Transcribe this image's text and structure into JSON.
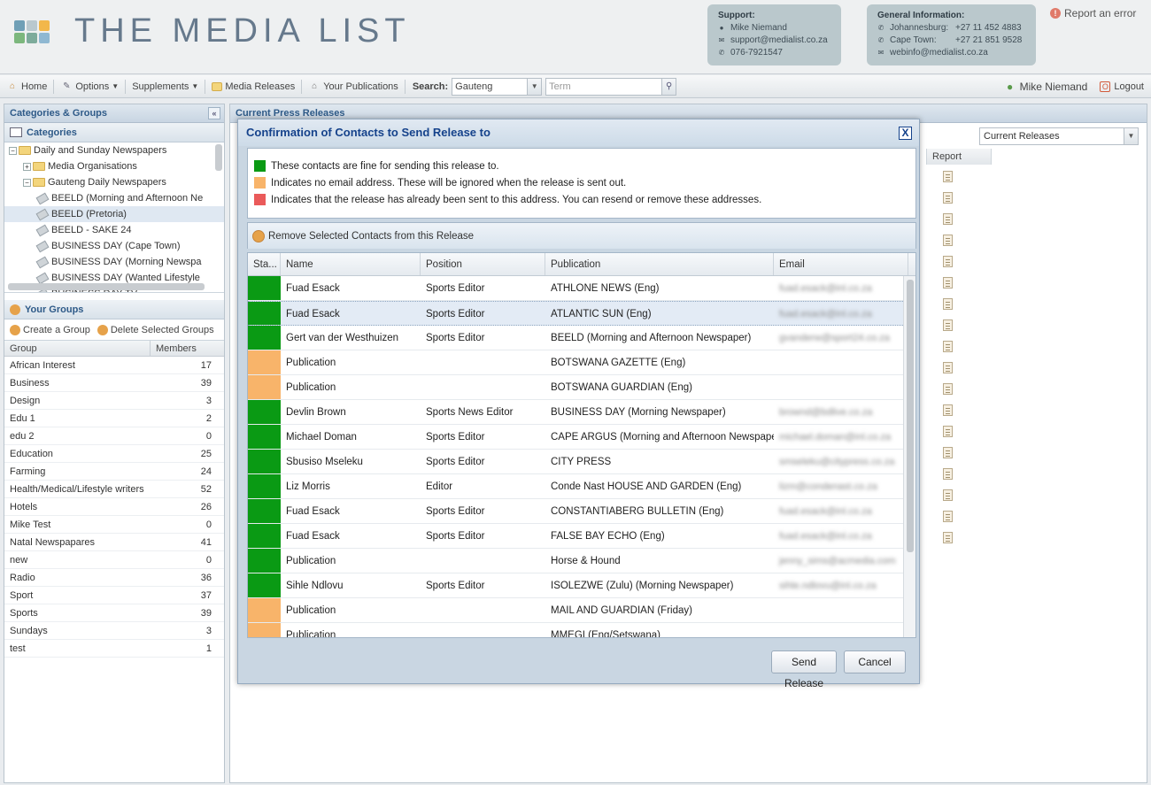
{
  "header": {
    "logo_text": "THE MEDIA LIST",
    "logo_colors": [
      "#6f9fb6",
      "#b9c8ce",
      "#f2b74a",
      "#7cb77d",
      "#7dab9b",
      "#8fb8d2"
    ],
    "support": {
      "title": "Support:",
      "name": "Mike Niemand",
      "email": "support@medialist.co.za",
      "phone": "076-7921547"
    },
    "general": {
      "title": "General Information:",
      "jhb_label": "Johannesburg:",
      "jhb_phone": "+27 11 452 4883",
      "cpt_label": "Cape Town:",
      "cpt_phone": "+27 21 851 9528",
      "email": "webinfo@medialist.co.za"
    },
    "report_error": "Report an error"
  },
  "toolbar": {
    "home": "Home",
    "options": "Options",
    "supplements": "Supplements",
    "media_releases": "Media Releases",
    "your_publications": "Your Publications",
    "search_label": "Search:",
    "search_select": "Gauteng",
    "search_placeholder": "Term",
    "user": "Mike Niemand",
    "logout": "Logout"
  },
  "left": {
    "panel_title": "Categories & Groups",
    "categories_title": "Categories",
    "tree": [
      {
        "label": "Daily and Sunday Newspapers",
        "indent": 0,
        "type": "folder-open"
      },
      {
        "label": "Media Organisations",
        "indent": 1,
        "type": "folder-closed"
      },
      {
        "label": "Gauteng Daily Newspapers",
        "indent": 1,
        "type": "folder-open"
      },
      {
        "label": "BEELD (Morning and Afternoon Ne",
        "indent": 2,
        "type": "tag"
      },
      {
        "label": "BEELD (Pretoria)",
        "indent": 2,
        "type": "tag",
        "selected": true
      },
      {
        "label": "BEELD - SAKE 24",
        "indent": 2,
        "type": "tag"
      },
      {
        "label": "BUSINESS DAY (Cape Town)",
        "indent": 2,
        "type": "tag"
      },
      {
        "label": "BUSINESS DAY (Morning Newspa",
        "indent": 2,
        "type": "tag"
      },
      {
        "label": "BUSINESS DAY (Wanted Lifestyle",
        "indent": 2,
        "type": "tag"
      },
      {
        "label": "BUSINESS DAY TV",
        "indent": 2,
        "type": "tag"
      }
    ],
    "groups_title": "Your Groups",
    "create_group": "Create a Group",
    "delete_groups": "Delete Selected Groups",
    "group_col": "Group",
    "members_col": "Members",
    "groups": [
      {
        "name": "African Interest",
        "members": "17"
      },
      {
        "name": "Business",
        "members": "39"
      },
      {
        "name": "Design",
        "members": "3"
      },
      {
        "name": "Edu 1",
        "members": "2"
      },
      {
        "name": "edu 2",
        "members": "0"
      },
      {
        "name": "Education",
        "members": "25"
      },
      {
        "name": "Farming",
        "members": "24"
      },
      {
        "name": "Health/Medical/Lifestyle writers",
        "members": "52"
      },
      {
        "name": "Hotels",
        "members": "26"
      },
      {
        "name": "Mike Test",
        "members": "0"
      },
      {
        "name": "Natal Newspapares",
        "members": "41"
      },
      {
        "name": "new",
        "members": "0"
      },
      {
        "name": "Radio",
        "members": "36"
      },
      {
        "name": "Sport",
        "members": "37"
      },
      {
        "name": "Sports",
        "members": "39"
      },
      {
        "name": "Sundays",
        "members": "3"
      },
      {
        "name": "test",
        "members": "1"
      }
    ]
  },
  "right": {
    "panel_title": "Current Press Releases",
    "filter_select": "Current Releases",
    "report_col": "Report"
  },
  "modal": {
    "title": "Confirmation of Contacts to Send Release to",
    "close": "X",
    "legend": [
      {
        "color": "#0a9a14",
        "text": "These contacts are fine for sending this release to."
      },
      {
        "color": "#f8b46a",
        "text": "Indicates no email address. These will be ignored when the release is sent out."
      },
      {
        "color": "#ea5a5a",
        "text": "Indicates that the release has already been sent to this address. You can resend or remove these addresses."
      }
    ],
    "remove_label": "Remove Selected Contacts from this Release",
    "columns": [
      "Sta...",
      "Name",
      "Position",
      "Publication",
      "Email"
    ],
    "rows": [
      {
        "status": "#0a9a14",
        "name": "Fuad Esack",
        "position": "Sports Editor",
        "publication": "ATHLONE NEWS (Eng)",
        "email": "fuad.esack@inl.co.za"
      },
      {
        "status": "#0a9a14",
        "name": "Fuad Esack",
        "position": "Sports Editor",
        "publication": "ATLANTIC SUN (Eng)",
        "email": "fuad.esack@inl.co.za",
        "highlight": true
      },
      {
        "status": "#0a9a14",
        "name": "Gert van der Westhuizen",
        "position": "Sports Editor",
        "publication": "BEELD (Morning and Afternoon Newspaper)",
        "email": "gvanderw@sport24.co.za"
      },
      {
        "status": "#f8b46a",
        "name": "Publication",
        "position": "",
        "publication": "BOTSWANA GAZETTE (Eng)",
        "email": ""
      },
      {
        "status": "#f8b46a",
        "name": "Publication",
        "position": "",
        "publication": "BOTSWANA GUARDIAN (Eng)",
        "email": ""
      },
      {
        "status": "#0a9a14",
        "name": "Devlin Brown",
        "position": "Sports News Editor",
        "publication": "BUSINESS DAY (Morning Newspaper)",
        "email": "brownd@bdlive.co.za"
      },
      {
        "status": "#0a9a14",
        "name": "Michael Doman",
        "position": "Sports Editor",
        "publication": "CAPE ARGUS (Morning and Afternoon Newspaper)",
        "email": "michael.doman@inl.co.za"
      },
      {
        "status": "#0a9a14",
        "name": "Sbusiso Mseleku",
        "position": "Sports Editor",
        "publication": "CITY PRESS",
        "email": "smseleku@citypress.co.za"
      },
      {
        "status": "#0a9a14",
        "name": "Liz Morris",
        "position": "Editor",
        "publication": "Conde Nast HOUSE AND GARDEN (Eng)",
        "email": "lizm@condenast.co.za"
      },
      {
        "status": "#0a9a14",
        "name": "Fuad Esack",
        "position": "Sports Editor",
        "publication": "CONSTANTIABERG BULLETIN (Eng)",
        "email": "fuad.esack@inl.co.za"
      },
      {
        "status": "#0a9a14",
        "name": "Fuad Esack",
        "position": "Sports Editor",
        "publication": "FALSE BAY ECHO (Eng)",
        "email": "fuad.esack@inl.co.za"
      },
      {
        "status": "#0a9a14",
        "name": "Publication",
        "position": "",
        "publication": "Horse & Hound",
        "email": "jenny_sims@acmedia.com"
      },
      {
        "status": "#0a9a14",
        "name": "Sihle Ndlovu",
        "position": "Sports Editor",
        "publication": "ISOLEZWE (Zulu) (Morning Newspaper)",
        "email": "sihle.ndlovu@inl.co.za"
      },
      {
        "status": "#f8b46a",
        "name": "Publication",
        "position": "",
        "publication": "MAIL AND GUARDIAN (Friday)",
        "email": ""
      },
      {
        "status": "#f8b46a",
        "name": "Publication",
        "position": "",
        "publication": "MMEGI (Eng/Setswana)",
        "email": ""
      }
    ],
    "send_button": "Send Release",
    "cancel_button": "Cancel"
  }
}
